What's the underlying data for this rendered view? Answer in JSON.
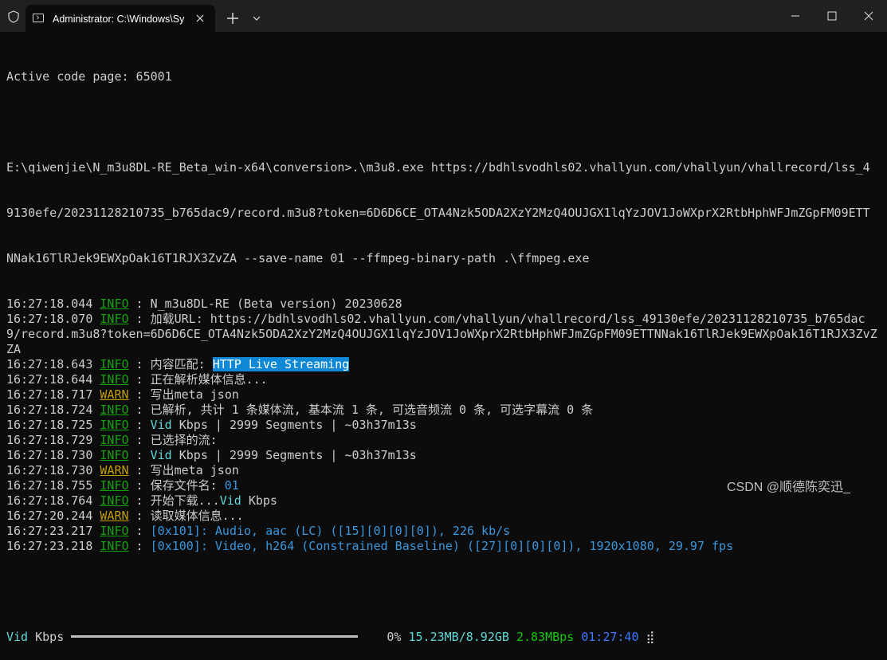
{
  "window": {
    "tab_title": "Administrator: C:\\Windows\\Sy",
    "colors": {
      "background": "#0c0c0c",
      "titlebar": "#202020",
      "text": "#cccccc",
      "info": "#13a10e",
      "warn": "#c19c00",
      "accent": "#3a96dd",
      "highlight": "#0f88d6"
    },
    "icons": [
      "shield-icon",
      "terminal-icon",
      "close-icon",
      "plus-icon",
      "chevron-down-icon",
      "minimize-icon",
      "maximize-icon",
      "close-window-icon"
    ]
  },
  "terminal": {
    "codepage": "Active code page: 65001",
    "command_lines": [
      "E:\\qiwenjie\\N_m3u8DL-RE_Beta_win-x64\\conversion>.\\m3u8.exe https://bdhlsvodhls02.vhallyun.com/vhallyun/vhallrecord/lss_4",
      "9130efe/20231128210735_b765dac9/record.m3u8?token=6D6D6CE_OTA4Nzk5ODA2XzY2MzQ4OUJGX1lqYzJOV1JoWXprX2RtbHphWFJmZGpFM09ETT",
      "NNak16TlRJek9EWXpOak16T1RJX3ZvZA --save-name 01 --ffmpeg-binary-path .\\ffmpeg.exe"
    ],
    "log": [
      {
        "time": "16:27:18.044",
        "level": "INFO",
        "msg": "N_m3u8DL-RE (Beta version) 20230628"
      },
      {
        "time": "16:27:18.070",
        "level": "INFO",
        "msg": "加载URL: https://bdhlsvodhls02.vhallyun.com/vhallyun/vhallrecord/lss_49130efe/20231128210735_b765dac"
      },
      {
        "cont": "9/record.m3u8?token=6D6D6CE_OTA4Nzk5ODA2XzY2MzQ4OUJGX1lqYzJOV1JoWXprX2RtbHphWFJmZGpFM09ETTNNak16TlRJek9EWXpOak16T1RJX3ZvZ"
      },
      {
        "cont": "ZA"
      },
      {
        "time": "16:27:18.643",
        "level": "INFO",
        "msg": "内容匹配: ",
        "hl": "HTTP Live Streaming"
      },
      {
        "time": "16:27:18.644",
        "level": "INFO",
        "msg": "正在解析媒体信息..."
      },
      {
        "time": "16:27:18.717",
        "level": "WARN",
        "msg": "写出meta json"
      },
      {
        "time": "16:27:18.724",
        "level": "INFO",
        "msg": "已解析, 共计 1 条媒体流, 基本流 1 条, 可选音频流 0 条, 可选字幕流 0 条"
      },
      {
        "time": "16:27:18.725",
        "level": "INFO",
        "pre": "Vid",
        "msg": " Kbps | 2999 Segments | ~03h37m13s"
      },
      {
        "time": "16:27:18.729",
        "level": "INFO",
        "msg": "已选择的流:"
      },
      {
        "time": "16:27:18.730",
        "level": "INFO",
        "pre": "Vid",
        "msg": " Kbps | 2999 Segments | ~03h37m13s"
      },
      {
        "time": "16:27:18.730",
        "level": "WARN",
        "msg": "写出meta json"
      },
      {
        "time": "16:27:18.755",
        "level": "INFO",
        "msg": "保存文件名: ",
        "blue": "01"
      },
      {
        "time": "16:27:18.764",
        "level": "INFO",
        "msg": "开始下载...",
        "mid": "Vid",
        "tail": " Kbps"
      },
      {
        "time": "16:27:20.244",
        "level": "WARN",
        "msg": "读取媒体信息..."
      },
      {
        "time": "16:27:23.217",
        "level": "INFO",
        "blue": "[0x101]: Audio, aac (LC) ([15][0][0][0]), 226 kb/s"
      },
      {
        "time": "16:27:23.218",
        "level": "INFO",
        "blue": "[0x100]: Video, h264 (Constrained Baseline) ([27][0][0][0]), 1920x1080, 29.97 fps"
      }
    ],
    "progress": {
      "label_prefix": "Vid",
      "label_suffix": " Kbps",
      "percent": "0%",
      "size": "15.23MB/8.92GB",
      "speed": "2.83MBps",
      "eta": "01:27:40",
      "spinner": "⣾"
    }
  },
  "watermark": "CSDN @顺德陈奕迅_"
}
